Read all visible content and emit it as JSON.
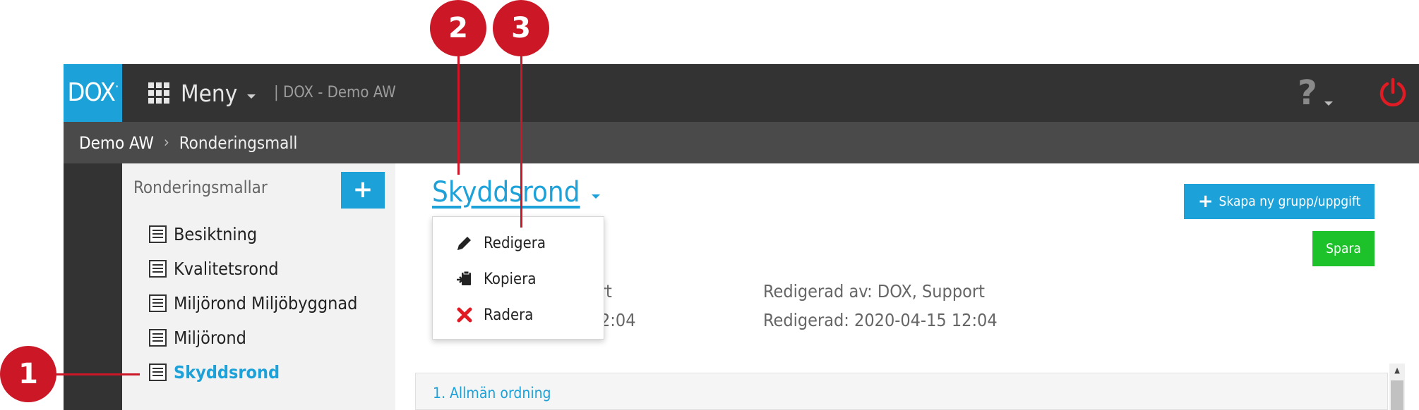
{
  "app": {
    "logo_text": "DOX",
    "menu_label": "Meny",
    "site_title": "| DOX - Demo AW",
    "help_glyph": "?",
    "accent_color": "#1da1d9",
    "danger_color": "#e01b24"
  },
  "breadcrumb": {
    "root": "Demo AW",
    "current": "Ronderingsmall"
  },
  "sidebar": {
    "header": "Ronderingsmallar",
    "add_label": "+",
    "items": [
      {
        "label": "Besiktning",
        "active": false
      },
      {
        "label": "Kvalitetsrond",
        "active": false
      },
      {
        "label": "Miljörond Miljöbyggnad",
        "active": false
      },
      {
        "label": "Miljörond",
        "active": false
      },
      {
        "label": "Skyddsrond",
        "active": true
      }
    ]
  },
  "main": {
    "title": "Skyddsrond",
    "create_label": "Skapa ny grupp/uppgift",
    "save_label": "Spara",
    "created_by_partial": "ort",
    "created_partial": "2:04",
    "edited_by": "Redigerad av: DOX, Support",
    "edited_at": "Redigerad: 2020-04-15 12:04",
    "section_title": "1. Allmän ordning"
  },
  "dropdown": {
    "items": [
      {
        "label": "Redigera",
        "icon": "pencil-icon"
      },
      {
        "label": "Kopiera",
        "icon": "copy-icon"
      },
      {
        "label": "Radera",
        "icon": "delete-icon"
      }
    ]
  },
  "callouts": [
    "1",
    "2",
    "3"
  ]
}
